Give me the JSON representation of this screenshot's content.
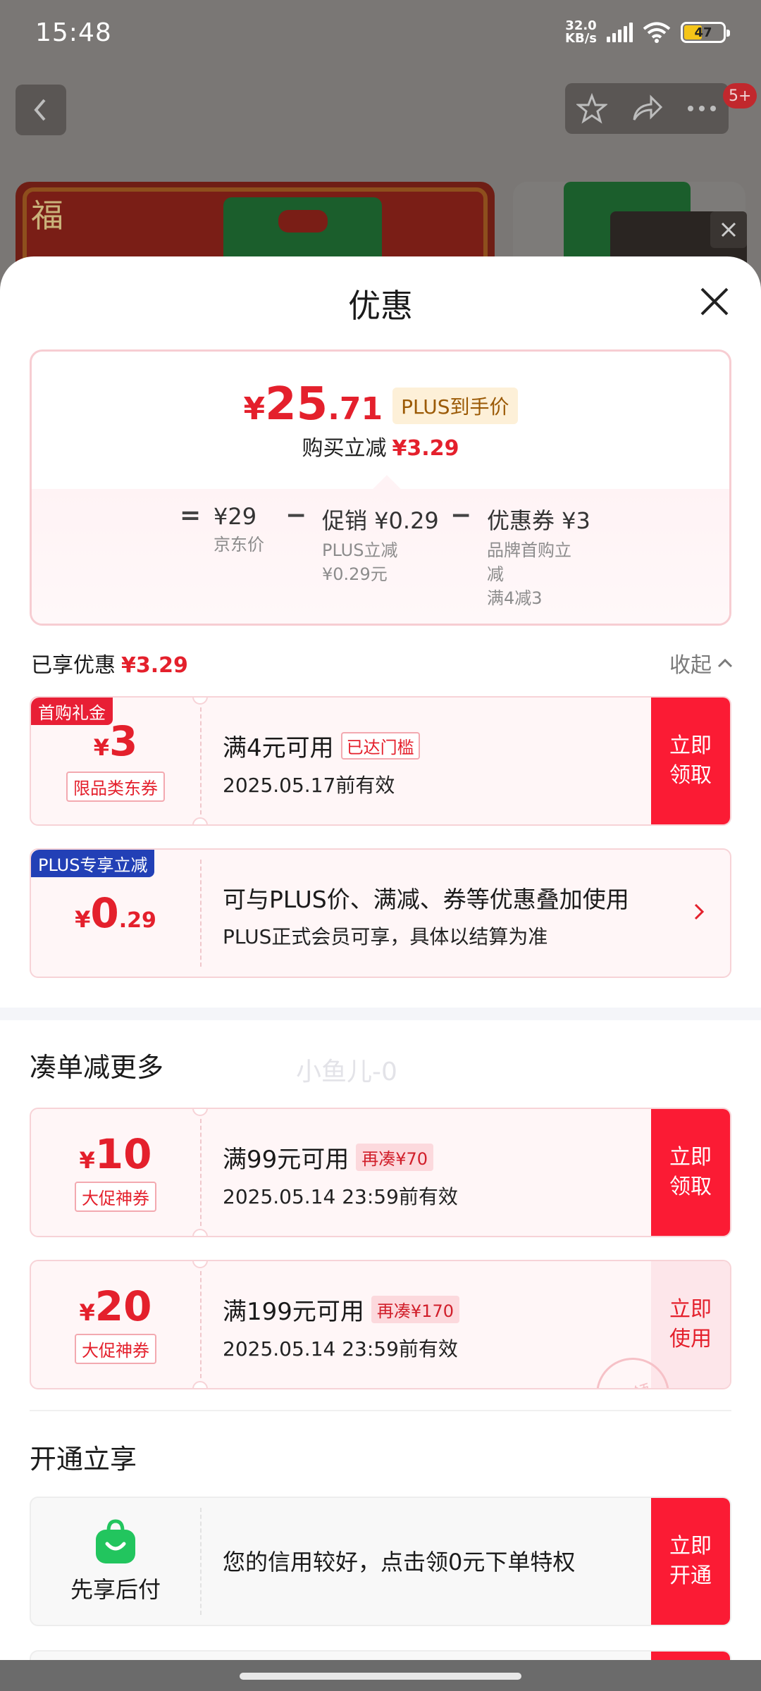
{
  "status_bar": {
    "time": "15:48",
    "net_speed_value": "32.0",
    "net_speed_unit": "KB/s",
    "battery": "47"
  },
  "background_page": {
    "cart_badge": "5+",
    "brand_glyph": "福"
  },
  "sheet": {
    "title": "优惠",
    "summary": {
      "currency": "¥",
      "price_int": "25",
      "price_dec": ".71",
      "plus_label": "PLUS到手价",
      "cut_label": "购买立减",
      "cut_value": "¥3.29",
      "equals": "=",
      "minus": "−",
      "base": {
        "value": "¥29",
        "label": "京东价"
      },
      "promo": {
        "value": "促销 ¥0.29",
        "sub1": "PLUS立减",
        "sub2": "¥0.29元"
      },
      "coupon": {
        "value": "优惠券 ¥3",
        "sub1": "品牌首购立",
        "sub2": "减",
        "sub3": "满4减3"
      }
    },
    "enjoyed_label": "已享优惠",
    "enjoyed_value": "¥3.29",
    "collapse_label": "收起",
    "coupons_applied": [
      {
        "corner": "首购礼金",
        "currency": "¥",
        "amount": "3",
        "tag": "限品类东券",
        "title": "满4元可用",
        "chip": "已达门槛",
        "validity": "2025.05.17前有效",
        "button": [
          "立即",
          "领取"
        ]
      },
      {
        "corner": "PLUS专享立减",
        "currency": "¥",
        "amount": "0",
        "amount_dec": ".29",
        "title": "可与PLUS价、满减、券等优惠叠加使用",
        "validity": "PLUS正式会员可享，具体以结算为准"
      }
    ],
    "watermark": "小鱼儿-0",
    "more_title": "凑单减更多",
    "coupons_more": [
      {
        "currency": "¥",
        "amount": "10",
        "tag": "大促神券",
        "title": "满99元可用",
        "chip": "再凑¥70",
        "validity": "2025.05.14 23:59前有效",
        "button": [
          "立即",
          "领取"
        ]
      },
      {
        "currency": "¥",
        "amount": "20",
        "tag": "大促神券",
        "title": "满199元可用",
        "chip": "再凑¥170",
        "validity": "2025.05.14 23:59前有效",
        "button": [
          "立即",
          "使用"
        ],
        "stamp": "已领"
      }
    ],
    "open_title": "开通立享",
    "pay_later": {
      "label": "先享后付",
      "text": "您的信用较好，点击领0元下单特权",
      "button": [
        "立即",
        "开通"
      ]
    }
  },
  "colors": {
    "accent_red": "#e4202c",
    "button_red": "#fb1b34",
    "plus_blue": "#2240b6",
    "pay_green": "#22c55e"
  }
}
